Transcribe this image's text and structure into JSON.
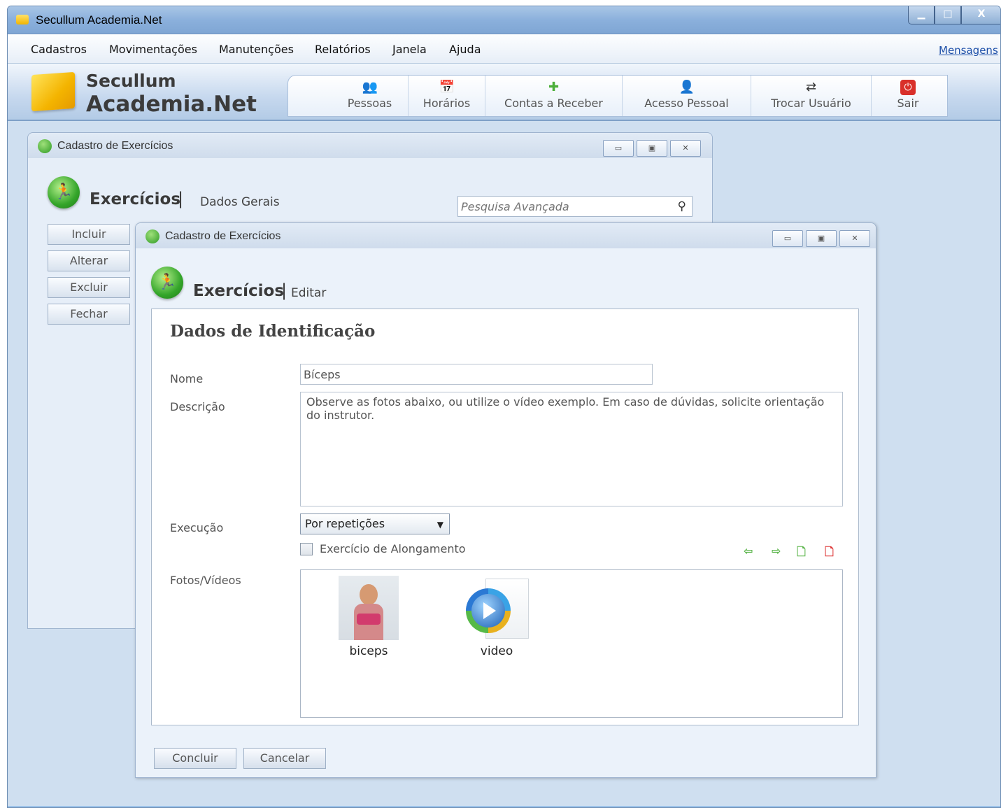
{
  "app": {
    "title": "Secullum Academia.Net",
    "controls": {
      "minimize": "▁",
      "maximize": "□",
      "close": "X"
    }
  },
  "menu": {
    "items": [
      "Cadastros",
      "Movimentações",
      "Manutenções",
      "Relatórios",
      "Janela",
      "Ajuda"
    ],
    "messages": "Mensagens"
  },
  "logo": {
    "line1": "Secullum",
    "line2": "Academia.Net"
  },
  "toolbar": {
    "buttons": [
      {
        "label": "Pessoas",
        "icon": "people-icon"
      },
      {
        "label": "Horários",
        "icon": "calendar-icon"
      },
      {
        "label": "Contas a Receber",
        "icon": "receivable-icon"
      },
      {
        "label": "Acesso Pessoal",
        "icon": "person-access-icon"
      },
      {
        "label": "Trocar Usuário",
        "icon": "switch-user-icon"
      },
      {
        "label": "Sair",
        "icon": "power-icon"
      }
    ]
  },
  "outer_dialog": {
    "title": "Cadastro de Exercícios",
    "heading": "Exercícios",
    "separator": "|",
    "subheading": "Dados Gerais",
    "search_placeholder": "Pesquisa Avançada",
    "side_buttons": [
      "Incluir",
      "Alterar",
      "Excluir",
      "Fechar"
    ]
  },
  "inner_dialog": {
    "title": "Cadastro de Exercícios",
    "heading": "Exercícios",
    "separator": "|",
    "subheading": "Editar",
    "panel_title": "Dados de Identificação",
    "labels": {
      "nome": "Nome",
      "descricao": "Descrição",
      "execucao": "Execução",
      "fotos": "Fotos/Vídeos"
    },
    "values": {
      "nome": "Bíceps",
      "descricao": "Observe as fotos abaixo, ou utilize o vídeo exemplo. Em caso de dúvidas, solicite orientação do instrutor.",
      "execucao": "Por repetições"
    },
    "checkbox": {
      "label": "Exercício de Alongamento",
      "checked": false
    },
    "media": [
      {
        "caption": "biceps",
        "kind": "photo"
      },
      {
        "caption": "video",
        "kind": "video"
      }
    ],
    "buttons": {
      "confirm": "Concluir",
      "cancel": "Cancelar"
    }
  }
}
